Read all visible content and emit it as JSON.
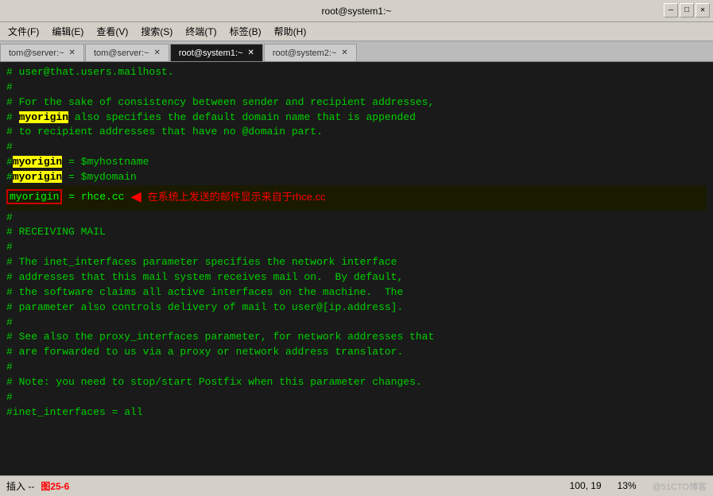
{
  "titleBar": {
    "title": "root@system1:~",
    "minimizeLabel": "—",
    "maximizeLabel": "□",
    "closeLabel": "✕"
  },
  "menuBar": {
    "items": [
      {
        "label": "文件(F)"
      },
      {
        "label": "编辑(E)"
      },
      {
        "label": "查看(V)"
      },
      {
        "label": "搜索(S)"
      },
      {
        "label": "终端(T)"
      },
      {
        "label": "标签(B)"
      },
      {
        "label": "帮助(H)"
      }
    ]
  },
  "tabs": [
    {
      "label": "tom@server:~",
      "active": false
    },
    {
      "label": "tom@server:~",
      "active": false
    },
    {
      "label": "root@system1:~",
      "active": true
    },
    {
      "label": "root@system2:~",
      "active": false
    }
  ],
  "terminal": {
    "lines": [
      {
        "type": "comment",
        "text": "# user@that.users.mailhost."
      },
      {
        "type": "comment",
        "text": "#"
      },
      {
        "type": "comment",
        "text": "# For the sake of consistency between sender and recipient addresses,"
      },
      {
        "type": "comment-highlight",
        "before": "# ",
        "highlight": "myorigin",
        "after": " also specifies the default domain name that is appended"
      },
      {
        "type": "comment",
        "text": "# to recipient addresses that have no @domain part."
      },
      {
        "type": "comment",
        "text": "#"
      },
      {
        "type": "code-highlight",
        "before": "#",
        "highlight": "myorigin",
        "after": " = $myhostname"
      },
      {
        "type": "code-highlight",
        "before": "#",
        "highlight": "myorigin",
        "after": " = $mydomain"
      },
      {
        "type": "active-annotation",
        "prefix": "myorigin",
        "middle": " = rhce.cc",
        "annotation": "在系统上发送的邮件显示来自于rhce.cc"
      },
      {
        "type": "comment",
        "text": "#"
      },
      {
        "type": "comment",
        "text": "# RECEIVING MAIL"
      },
      {
        "type": "comment",
        "text": "#"
      },
      {
        "type": "comment",
        "text": "# The inet_interfaces parameter specifies the network interface"
      },
      {
        "type": "comment",
        "text": "# addresses that this mail system receives mail on.  By default,"
      },
      {
        "type": "comment",
        "text": "# the software claims all active interfaces on the machine.  The"
      },
      {
        "type": "comment",
        "text": "# parameter also controls delivery of mail to user@[ip.address]."
      },
      {
        "type": "comment",
        "text": "#"
      },
      {
        "type": "comment",
        "text": "# See also the proxy_interfaces parameter, for network addresses that"
      },
      {
        "type": "comment",
        "text": "# are forwarded to us via a proxy or network address translator."
      },
      {
        "type": "comment",
        "text": "#"
      },
      {
        "type": "comment",
        "text": "# Note: you need to stop/start Postfix when this parameter changes."
      },
      {
        "type": "comment",
        "text": "#"
      },
      {
        "type": "comment",
        "text": "#inet_interfaces = all"
      }
    ]
  },
  "statusBar": {
    "insertLabel": "插入 --",
    "figureLabel": "图25-6",
    "position": "100, 19",
    "zoom": "13%",
    "watermark": "@51CTO博客"
  },
  "annotation": {
    "text": "在系统上发送的邮件显示来自于rhce.cc"
  }
}
